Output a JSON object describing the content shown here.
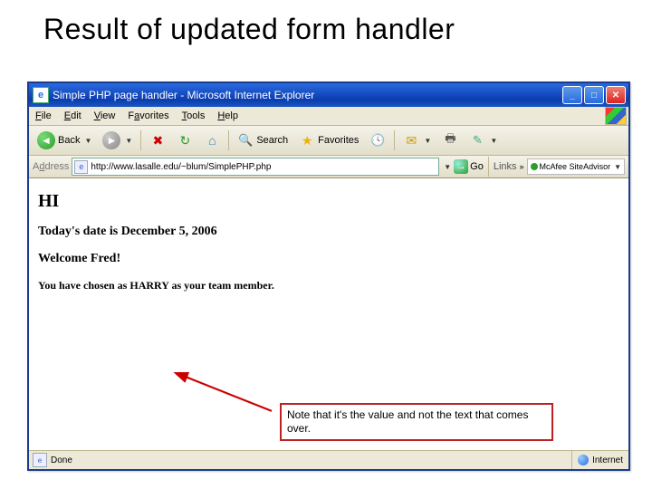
{
  "slide": {
    "title": "Result of updated form handler"
  },
  "window": {
    "title": "Simple PHP page handler - Microsoft Internet Explorer",
    "menus": [
      "File",
      "Edit",
      "View",
      "Favorites",
      "Tools",
      "Help"
    ],
    "toolbar": {
      "back": "Back",
      "search": "Search",
      "favorites": "Favorites"
    },
    "address_label": "Address",
    "url": "http://www.lasalle.edu/~blum/SimplePHP.php",
    "go": "Go",
    "links": "Links",
    "siteadvisor": "McAfee SiteAdvisor",
    "status_done": "Done",
    "status_zone": "Internet"
  },
  "page": {
    "h1": "HI",
    "date_line_prefix": "Today's date is ",
    "date_value": "December 5, 2006",
    "welcome_prefix": "Welcome ",
    "welcome_name": "Fred",
    "welcome_suffix": "!",
    "team_prefix": "You have chosen as ",
    "team_value": "HARRY",
    "team_suffix": " as your team member."
  },
  "callout": {
    "text": "Note that it's the value and not the text that comes over."
  }
}
